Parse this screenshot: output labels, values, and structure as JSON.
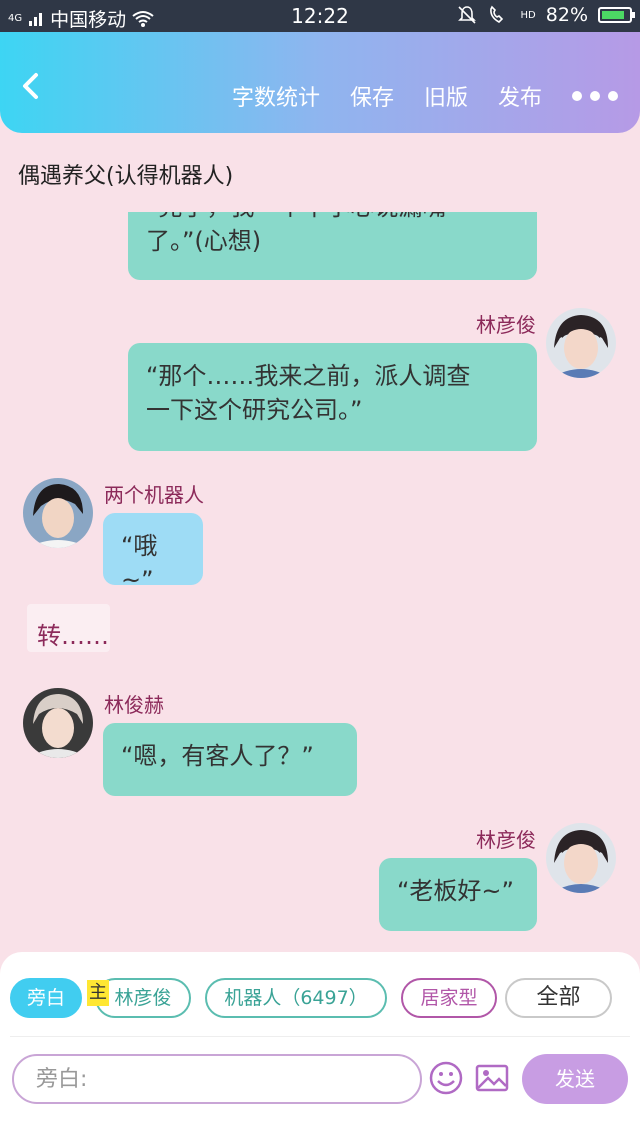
{
  "status_bar": {
    "network_type": "4G",
    "carrier": "中国移动",
    "time": "12:22",
    "hd_label": "HD",
    "battery": "82%"
  },
  "header": {
    "actions": [
      "字数统计",
      "保存",
      "旧版",
      "发布"
    ]
  },
  "story_title": "偶遇养父(认得机器人)",
  "messages": [
    {
      "speaker": "",
      "text": "“完了，我一个不小心说漏嘴了。”(心想)"
    },
    {
      "speaker": "林彦俊",
      "text_line1": "“那个……我来之前，派人调查",
      "text_line2": "一下这个研究公司。”"
    },
    {
      "speaker": "两个机器人",
      "text": "“哦~”"
    },
    {
      "narration": "转……"
    },
    {
      "speaker": "林俊赫",
      "text": "“嗯，有客人了？”"
    },
    {
      "speaker": "林彦俊",
      "text": "“老板好~”"
    }
  ],
  "partial_top_line1": "“完了，我一个不小心说漏嘴",
  "partial_top_line2": "了。”(心想)",
  "chips": [
    "旁白",
    "林彦俊",
    "机器人（6497）",
    "居家型",
    "全部"
  ],
  "host_tag": "主",
  "composer": {
    "placeholder": "旁白:",
    "send_label": "发送"
  },
  "colors": {
    "background": "#f9e1e8",
    "bubble_green": "#89d9ca",
    "bubble_blue": "#9edcf5",
    "name_color": "#8c2a5a",
    "header_gradient_start": "#3dd5f3",
    "header_gradient_end": "#b69ae6",
    "send_button": "#c89de3"
  }
}
